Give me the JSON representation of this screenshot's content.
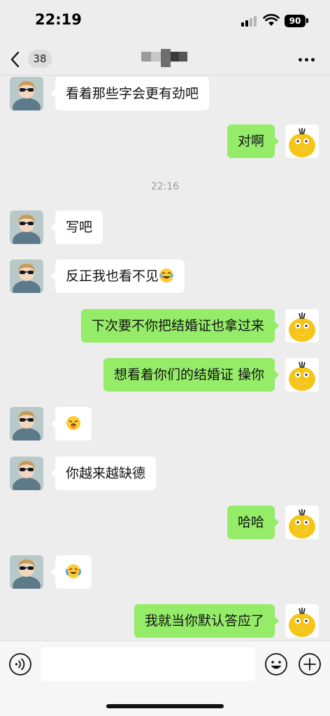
{
  "status_bar": {
    "time": "22:19",
    "battery": "90"
  },
  "nav": {
    "unread_count": "38",
    "title": ""
  },
  "messages": [
    {
      "side": "left",
      "text": "看着那些字会更有劲吧"
    },
    {
      "side": "right",
      "text": "对啊"
    },
    {
      "time": "22:16"
    },
    {
      "side": "left",
      "text": "写吧"
    },
    {
      "side": "left",
      "text": "反正我也看不见",
      "emoji": "tears-of-joy"
    },
    {
      "side": "right",
      "text": "下次要不你把结婚证也拿过来"
    },
    {
      "side": "right",
      "text": "想看着你们的结婚证 操你"
    },
    {
      "side": "left",
      "text": "",
      "emoji": "tongue-out"
    },
    {
      "side": "left",
      "text": "你越来越缺德"
    },
    {
      "side": "right",
      "text": "哈哈"
    },
    {
      "side": "left",
      "text": "",
      "emoji": "crying-laughing"
    },
    {
      "side": "right",
      "text": "我就当你默认答应了"
    }
  ],
  "input": {
    "value": "",
    "placeholder": ""
  },
  "colors": {
    "background": "#ededed",
    "sent_bubble": "#95ec69",
    "received_bubble": "#ffffff"
  }
}
